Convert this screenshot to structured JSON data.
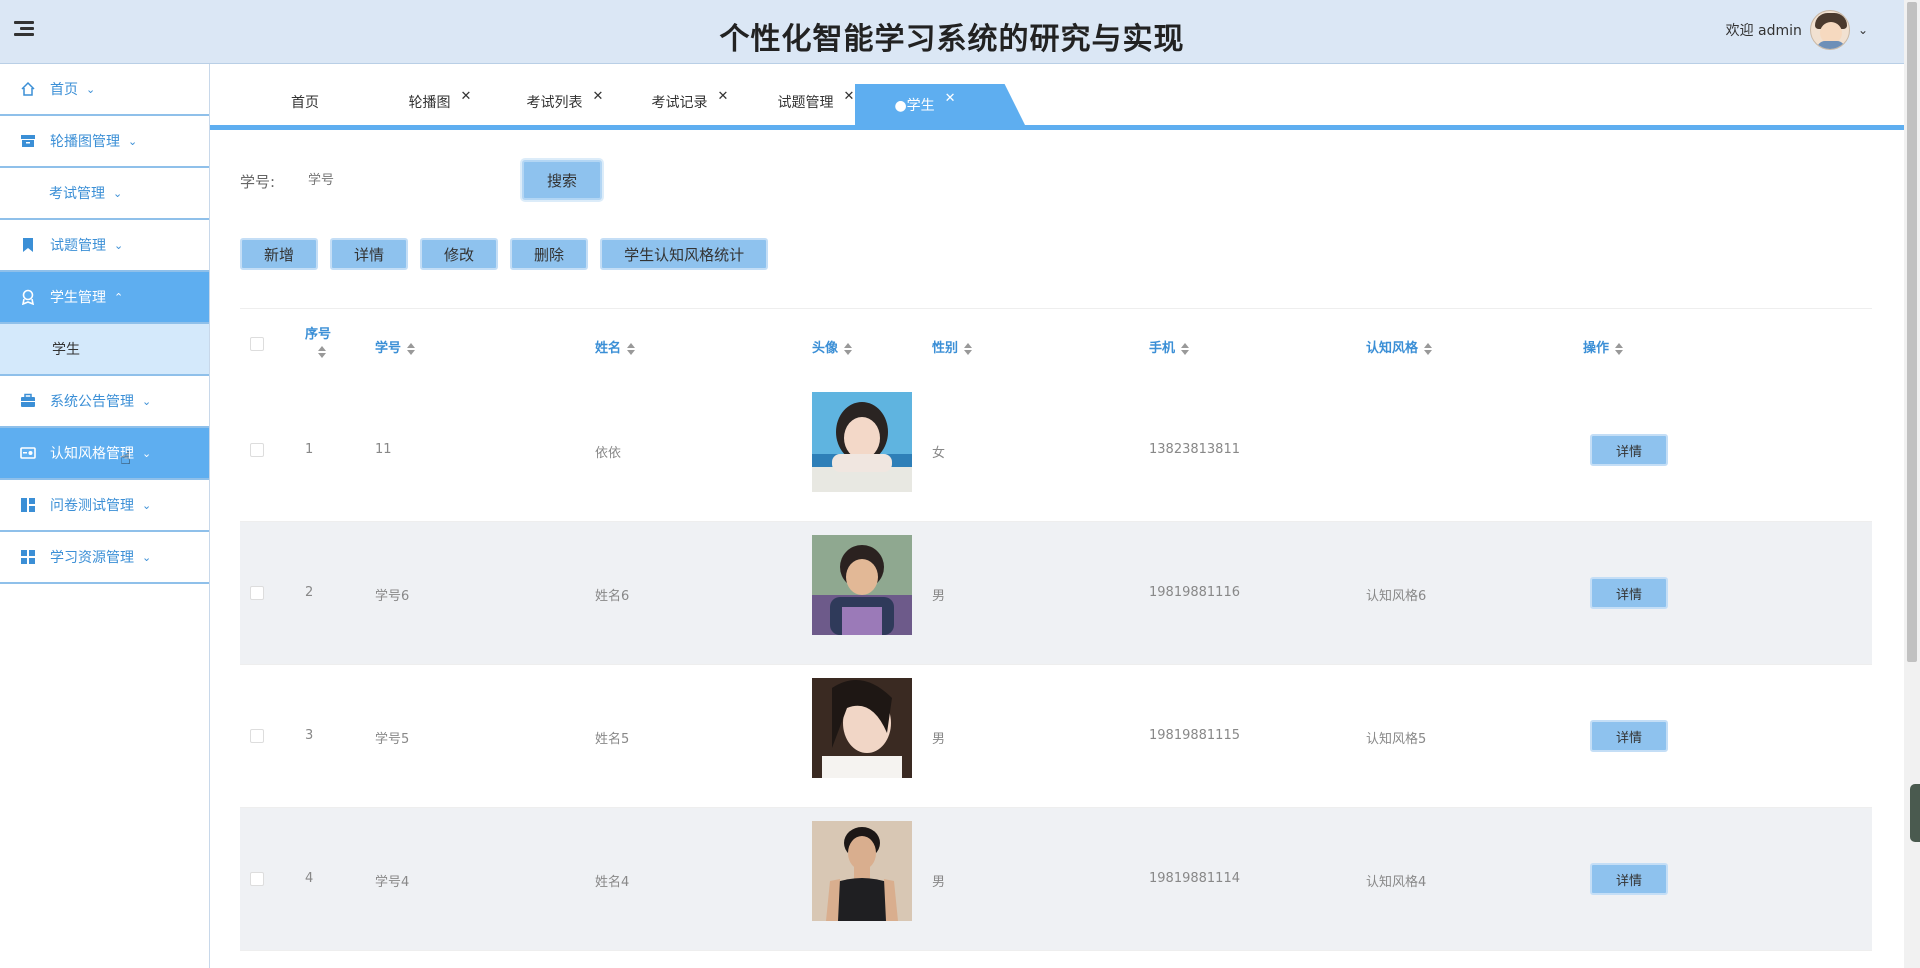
{
  "header": {
    "title": "个性化智能学习系统的研究与实现",
    "welcome": "欢迎 admin",
    "chevron": "⌵"
  },
  "sidebar": {
    "items": [
      {
        "label": "首页",
        "icon": "home-icon",
        "active": false
      },
      {
        "label": "轮播图管理",
        "icon": "archive-icon",
        "active": false
      },
      {
        "label": "考试管理",
        "icon": "",
        "active": false
      },
      {
        "label": "试题管理",
        "icon": "bookmark-icon",
        "active": false
      },
      {
        "label": "学生管理",
        "icon": "student-icon",
        "active": true
      },
      {
        "label": "学生",
        "sub": true
      },
      {
        "label": "系统公告管理",
        "icon": "briefcase-icon",
        "active": false
      },
      {
        "label": "认知风格管理",
        "icon": "id-card-icon",
        "active": true
      },
      {
        "label": "问卷测试管理",
        "icon": "dashboard-icon",
        "active": false
      },
      {
        "label": "学习资源管理",
        "icon": "grid-icon",
        "active": false
      }
    ]
  },
  "tabs": [
    {
      "label": "首页",
      "closable": false
    },
    {
      "label": "轮播图",
      "closable": true
    },
    {
      "label": "考试列表",
      "closable": true
    },
    {
      "label": "考试记录",
      "closable": true
    },
    {
      "label": "试题管理",
      "closable": true
    },
    {
      "label": "●学生",
      "closable": true,
      "active": true
    }
  ],
  "search": {
    "label": "学号:",
    "placeholder": "学号",
    "button": "搜索"
  },
  "actions": [
    "新增",
    "详情",
    "修改",
    "删除",
    "学生认知风格统计"
  ],
  "table": {
    "headers": {
      "index": "序号",
      "student_no": "学号",
      "name": "姓名",
      "avatar": "头像",
      "gender": "性别",
      "phone": "手机",
      "style": "认知风格",
      "op": "操作"
    },
    "rows": [
      {
        "index": "1",
        "student_no": "11",
        "name": "依依",
        "gender": "女",
        "phone": "13823813811",
        "style": "",
        "op": "详情"
      },
      {
        "index": "2",
        "student_no": "学号6",
        "name": "姓名6",
        "gender": "男",
        "phone": "19819881116",
        "style": "认知风格6",
        "op": "详情"
      },
      {
        "index": "3",
        "student_no": "学号5",
        "name": "姓名5",
        "gender": "男",
        "phone": "19819881115",
        "style": "认知风格5",
        "op": "详情"
      },
      {
        "index": "4",
        "student_no": "学号4",
        "name": "姓名4",
        "gender": "男",
        "phone": "19819881114",
        "style": "认知风格4",
        "op": "详情"
      }
    ]
  },
  "colors": {
    "accent": "#5eaef0",
    "header_bg": "#dbe7f5",
    "button_bg": "#8ec2ee",
    "link_blue": "#3b8fd6"
  }
}
